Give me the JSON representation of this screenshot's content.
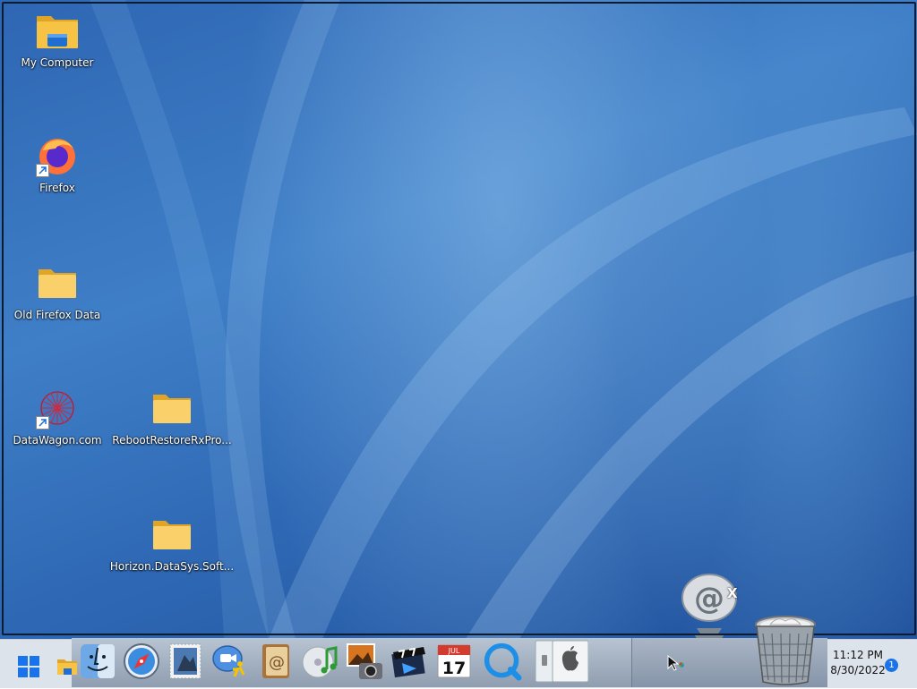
{
  "desktop_icons": [
    {
      "label": "My Computer",
      "icon": "folder-icon",
      "shortcut": false
    },
    {
      "label": "Firefox",
      "icon": "firefox-icon",
      "shortcut": true
    },
    {
      "label": "Old Firefox Data",
      "icon": "folder-icon",
      "shortcut": false
    },
    {
      "label": "DataWagon.com",
      "icon": "web-shortcut-icon",
      "shortcut": true
    },
    {
      "label": "RebootRestoreRxPro...",
      "icon": "folder-icon",
      "shortcut": false
    },
    {
      "label": "Horizon.DataSys.Soft...",
      "icon": "folder-icon",
      "shortcut": false
    }
  ],
  "dock_items": [
    {
      "name": "finder",
      "icon": "finder-icon"
    },
    {
      "name": "safari",
      "icon": "safari-icon"
    },
    {
      "name": "mail",
      "icon": "mail-stamp-icon"
    },
    {
      "name": "ichat",
      "icon": "ichat-icon"
    },
    {
      "name": "address-book",
      "icon": "address-book-icon"
    },
    {
      "name": "itunes",
      "icon": "itunes-icon"
    },
    {
      "name": "iphoto",
      "icon": "iphoto-icon"
    },
    {
      "name": "imovie",
      "icon": "imovie-icon"
    },
    {
      "name": "ical",
      "icon": "calendar-icon"
    },
    {
      "name": "quicktime",
      "icon": "quicktime-icon"
    },
    {
      "name": "system-preferences",
      "icon": "system-preferences-icon"
    }
  ],
  "calendar": {
    "month": "JUL",
    "day": "17"
  },
  "widget": {
    "close_glyph": "X",
    "icon": "at-sign-icon"
  },
  "clock": {
    "time": "11:12 PM",
    "date": "8/30/2022"
  },
  "notification_count": "1",
  "colors": {
    "folder": "#f6c344",
    "taskbar": "#dde3ea",
    "accent": "#1a73e8"
  }
}
